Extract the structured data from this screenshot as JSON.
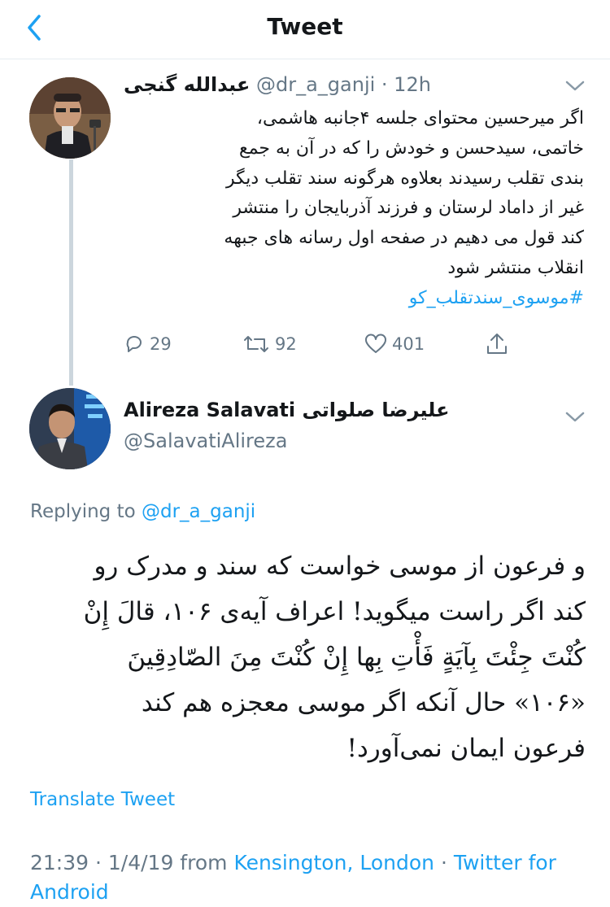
{
  "header": {
    "title": "Tweet"
  },
  "parent_tweet": {
    "author_name": "عبدالله گنجی",
    "handle": "@dr_a_ganji",
    "time": "12h",
    "text_lines": [
      "اگر میرحسین محتوای جلسه ۴جانبه هاشمی،",
      "خاتمی، سیدحسن و خودش را که در آن به جمع",
      "بندی تقلب رسیدند بعلاوه هرگونه سند تقلب دیگر",
      "غیر از داماد لرستان و فرزند آذربایجان  را منتشر",
      "کند قول می دهیم در صفحه اول رسانه های جبهه",
      "انقلاب منتشر شود"
    ],
    "hashtag": "#موسوی_سندتقلب_کو",
    "stats": {
      "replies": "29",
      "retweets": "92",
      "likes": "401"
    }
  },
  "reply_tweet": {
    "author_name": "Alireza Salavati علیرضا صلواتی",
    "handle": "@SalavatiAlireza",
    "replying_prefix": "Replying to",
    "replying_to": "@dr_a_ganji",
    "text_lines": [
      "و فرعون از موسی خواست که سند و مدرک رو",
      "کند اگر راست میگوید! اعراف آیه‌ی ۱۰۶،  قالَ إِنْ",
      "کُنْتَ جِئْتَ بِآيَةٍ فَأْتِ بِها إِنْ كُنْتَ مِنَ الصّادِقِينَ",
      "«۱۰۶» حال آنکه اگر موسی معجزه هم کند",
      "فرعون ایمان نمی‌آورد!"
    ],
    "translate_label": "Translate Tweet",
    "timestamp": "21:39 · 1/4/19 from",
    "location": "Kensington, London",
    "separator": "·",
    "source": "Twitter for Android"
  },
  "colors": {
    "link": "#1da1f2",
    "muted": "#657786",
    "text": "#14171a",
    "divider": "#e6ecf0"
  }
}
